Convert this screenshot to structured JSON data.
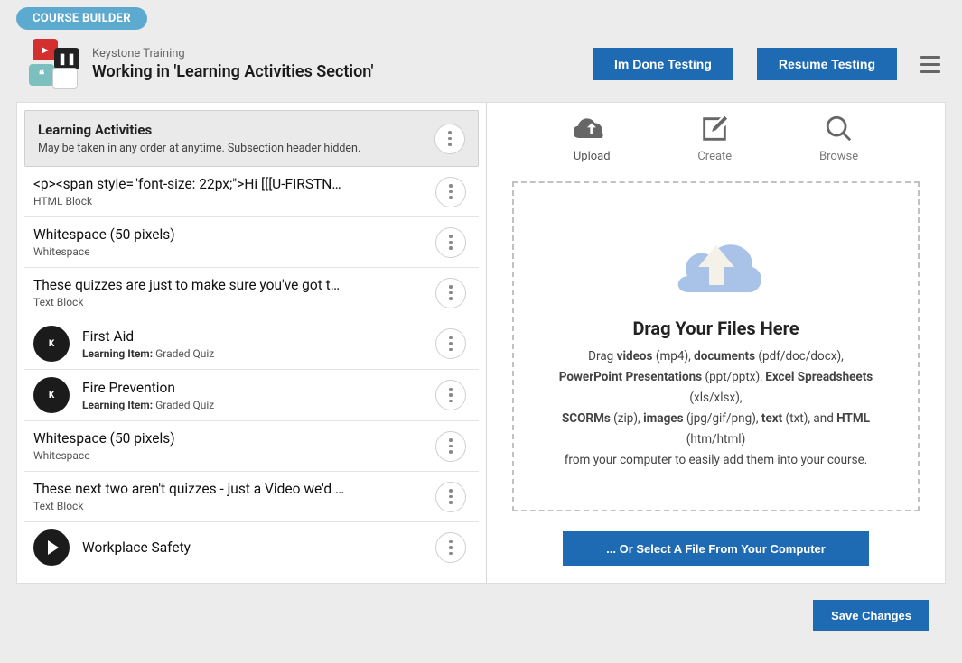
{
  "badge": "COURSE BUILDER",
  "header": {
    "org": "Keystone Training",
    "title": "Working in 'Learning Activities Section'",
    "btn_done": "Im Done Testing",
    "btn_resume": "Resume Testing"
  },
  "section": {
    "title": "Learning Activities",
    "subtitle": "May be taken in any order at anytime. Subsection header hidden."
  },
  "rows": [
    {
      "title": "<p><span style=\"font-size: 22px;\">Hi [[[U-FIRSTN…",
      "sub": "HTML Block"
    },
    {
      "title": "Whitespace (50 pixels)",
      "sub": "Whitespace"
    },
    {
      "title": "These quizzes are just to make sure you've got t…",
      "sub": "Text Block"
    },
    {
      "title": "First Aid",
      "sub_label": "Learning Item:",
      "sub_val": "Graded Quiz",
      "thumb": "quiz"
    },
    {
      "title": "Fire Prevention",
      "sub_label": "Learning Item:",
      "sub_val": "Graded Quiz",
      "thumb": "quiz"
    },
    {
      "title": "Whitespace (50 pixels)",
      "sub": "Whitespace"
    },
    {
      "title": "These next two aren't quizzes - just a Video we'd …",
      "sub": "Text Block"
    },
    {
      "title": "Workplace Safety",
      "sub_label": "",
      "sub_val": "",
      "thumb": "play"
    }
  ],
  "tabs": {
    "upload": "Upload",
    "create": "Create",
    "browse": "Browse"
  },
  "dropzone": {
    "title": "Drag Your Files Here",
    "l1a": "Drag ",
    "l1b": "videos",
    "l1c": " (mp4), ",
    "l1d": "documents",
    "l1e": " (pdf/doc/docx),",
    "l2a": "PowerPoint Presentations",
    "l2b": " (ppt/pptx), ",
    "l2c": "Excel Spreadsheets",
    "l2d": " (xls/xlsx),",
    "l3a": "SCORMs",
    "l3b": " (zip), ",
    "l3c": "images",
    "l3d": " (jpg/gif/png), ",
    "l3e": "text",
    "l3f": " (txt), and ",
    "l3g": "HTML",
    "l3h": " (htm/html)",
    "l4": "from your computer to easily add them into your course.",
    "select_btn": "... Or Select A File From Your Computer"
  },
  "footer": {
    "save": "Save Changes"
  }
}
